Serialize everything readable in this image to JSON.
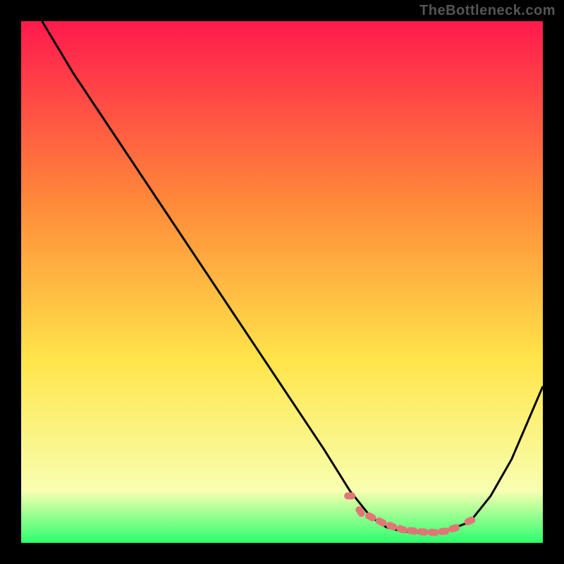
{
  "watermark": "TheBottleneck.com",
  "colors": {
    "background": "#000000",
    "gradient_top": "#ff1a4d",
    "gradient_mid": "#ffe54a",
    "gradient_bottom": "#2cff6e",
    "curve": "#000000",
    "marker_fill": "#e17676",
    "marker_stroke": "rgba(0,0,0,0)"
  },
  "chart_data": {
    "type": "line",
    "title": "",
    "xlabel": "",
    "ylabel": "",
    "xlim": [
      0,
      100
    ],
    "ylim": [
      0,
      100
    ],
    "curve_x": [
      4,
      10,
      20,
      30,
      40,
      50,
      58,
      63,
      67,
      70,
      73,
      76,
      79,
      82,
      86,
      90,
      94,
      100
    ],
    "curve_y": [
      100,
      90,
      75,
      60,
      45,
      30,
      18,
      10,
      5,
      3,
      2.2,
      2,
      2,
      2.5,
      4,
      9,
      16,
      30
    ],
    "markers_x": [
      63,
      65,
      67,
      69,
      71,
      73,
      75,
      77,
      79,
      81,
      83,
      86
    ],
    "markers_y": [
      9,
      6,
      5,
      4,
      3.2,
      2.6,
      2.3,
      2.1,
      2.0,
      2.2,
      2.8,
      4.2
    ],
    "grid": false,
    "legend": false
  }
}
